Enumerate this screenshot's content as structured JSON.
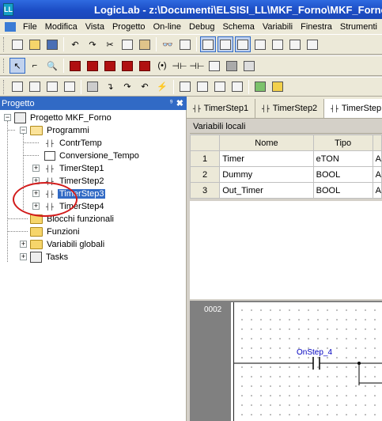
{
  "window": {
    "title": "LogicLab - z:\\Documenti\\ELSISI_LL\\MKF_Forno\\MKF_Forno.pr",
    "app_icon": "logiclab-icon"
  },
  "menu": [
    "File",
    "Modifica",
    "Vista",
    "Progetto",
    "On-line",
    "Debug",
    "Schema",
    "Variabili",
    "Finestra",
    "Strumenti"
  ],
  "project_panel": {
    "title": "Progetto",
    "pin_glyph": "⁹",
    "close_glyph": "✖",
    "root": "Progetto MKF_Forno",
    "programs_folder": "Programmi",
    "items": [
      "ContrTemp",
      "Conversione_Tempo",
      "TimerStep1",
      "TimerStep2",
      "TimerStep3",
      "TimerStep4"
    ],
    "function_blocks": "Blocchi funzionali",
    "functions": "Funzioni",
    "global_vars": "Variabili globali",
    "tasks": "Tasks",
    "selected": "TimerStep3"
  },
  "doc_tabs": [
    "TimerStep1",
    "TimerStep2",
    "TimerStep"
  ],
  "local_vars": {
    "title": "Variabili locali",
    "columns": [
      "Nome",
      "Tipo"
    ],
    "rows": [
      {
        "n": "1",
        "name": "Timer",
        "type": "eTON",
        "extra": "A"
      },
      {
        "n": "2",
        "name": "Dummy",
        "type": "BOOL",
        "extra": "A"
      },
      {
        "n": "3",
        "name": "Out_Timer",
        "type": "BOOL",
        "extra": "A"
      }
    ]
  },
  "ladder": {
    "rung_number": "0002",
    "contact_label": "OnStep_4"
  }
}
